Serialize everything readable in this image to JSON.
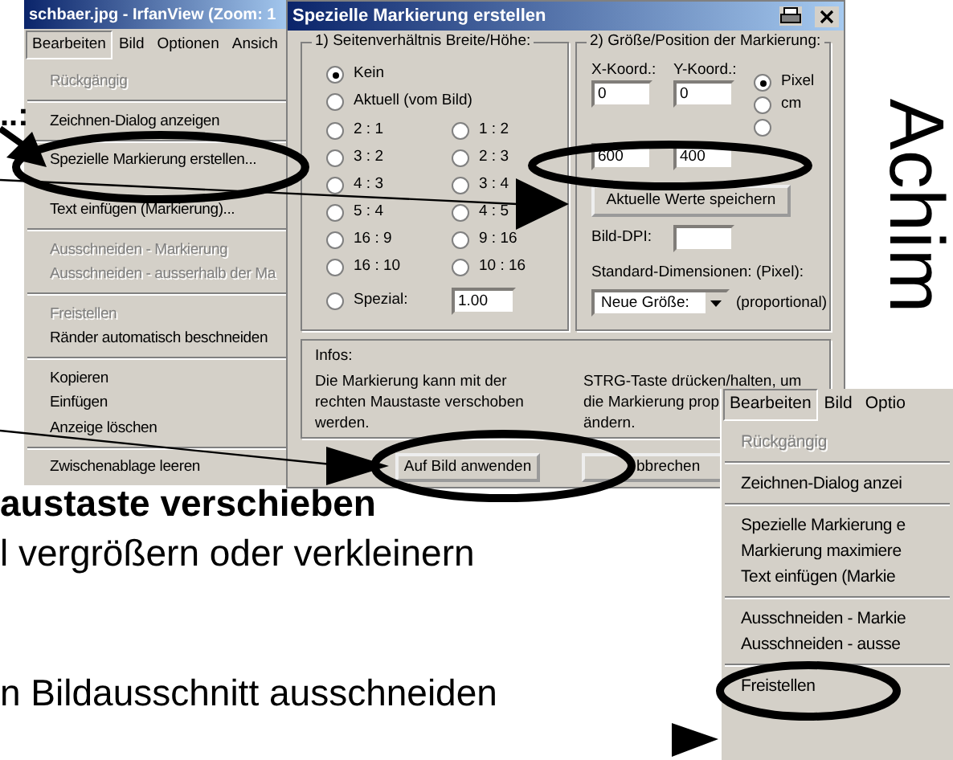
{
  "main_window": {
    "title": "schbaer.jpg - IrfanView (Zoom: 1",
    "menu_bar": [
      {
        "label": "Bearbeiten",
        "selected": true
      },
      {
        "label": "Bild",
        "selected": false
      },
      {
        "label": "Optionen",
        "selected": false
      },
      {
        "label": "Ansich",
        "selected": false
      }
    ],
    "menu_items": [
      {
        "kind": "item",
        "label": "Rückgängig",
        "disabled": true
      },
      {
        "kind": "separator"
      },
      {
        "kind": "item",
        "label": "Zeichnen-Dialog anzeigen",
        "disabled": false
      },
      {
        "kind": "separator"
      },
      {
        "kind": "item",
        "label": "Spezielle Markierung erstellen...",
        "disabled": false
      },
      {
        "kind": "covered"
      },
      {
        "kind": "item",
        "label": "Text einfügen (Markierung)...",
        "disabled": false
      },
      {
        "kind": "separator"
      },
      {
        "kind": "item",
        "label": "Ausschneiden - Markierung",
        "disabled": true
      },
      {
        "kind": "item",
        "label": "Ausschneiden - ausserhalb der Ma",
        "disabled": true
      },
      {
        "kind": "separator"
      },
      {
        "kind": "item",
        "label": "Freistellen",
        "disabled": true
      },
      {
        "kind": "item",
        "label": "Ränder automatisch beschneiden",
        "disabled": false
      },
      {
        "kind": "separator"
      },
      {
        "kind": "item",
        "label": "Kopieren",
        "disabled": false
      },
      {
        "kind": "item",
        "label": "Einfügen",
        "disabled": false
      },
      {
        "kind": "item",
        "label": "Anzeige löschen",
        "disabled": false
      },
      {
        "kind": "separator"
      },
      {
        "kind": "item",
        "label": "Zwischenablage leeren",
        "disabled": false
      }
    ]
  },
  "dialog": {
    "title": "Spezielle Markierung erstellen",
    "aspect_group": {
      "title": "1) Seitenverhältnis Breite/Höhe:",
      "single_options": [
        {
          "label": "Kein",
          "checked": true
        },
        {
          "label": "Aktuell (vom Bild)",
          "checked": false
        }
      ],
      "ratio_options": [
        {
          "label": "2 : 1",
          "checked": false
        },
        {
          "label": "1 : 2",
          "checked": false
        },
        {
          "label": "3 : 2",
          "checked": false
        },
        {
          "label": "2 : 3",
          "checked": false
        },
        {
          "label": "4 : 3",
          "checked": false
        },
        {
          "label": "3 : 4",
          "checked": false
        },
        {
          "label": "5 : 4",
          "checked": false
        },
        {
          "label": "4 : 5",
          "checked": false
        },
        {
          "label": "16 : 9",
          "checked": false
        },
        {
          "label": "9 : 16",
          "checked": false
        },
        {
          "label": "16 : 10",
          "checked": false
        },
        {
          "label": "10 : 16",
          "checked": false
        }
      ],
      "custom": {
        "label": "Spezial:",
        "checked": false,
        "value": "1.00"
      }
    },
    "size_group": {
      "title": "2) Größe/Position der Markierung:",
      "x_label": "X-Koord.:",
      "y_label": "Y-Koord.:",
      "x_value": "0",
      "y_value": "0",
      "units": [
        {
          "label": "Pixel",
          "checked": true
        },
        {
          "label": "cm",
          "checked": false
        },
        {
          "checked": false
        }
      ],
      "width_value": "600",
      "height_value": "400",
      "save_button": "Aktuelle Werte speichern",
      "dpi_label": "Bild-DPI:",
      "dims_label": "Standard-Dimensionen: (Pixel):",
      "dims_select": "Neue Größe:",
      "dims_note": "(proportional)"
    },
    "infos": {
      "title": "Infos:",
      "left_text": "Die Markierung kann mit der rechten Maustaste verschoben werden.",
      "right_lines": [
        "STRG-Taste drücken/halten, um",
        "die Markierung prop",
        "ändern."
      ]
    },
    "buttons": [
      "Auf Bild anwenden",
      "bbrechen"
    ]
  },
  "second_window": {
    "menu_bar": [
      {
        "label": "Bearbeiten",
        "selected": true
      },
      {
        "label": "Bild",
        "selected": false
      },
      {
        "label": "Optio",
        "selected": false
      }
    ],
    "menu_items": [
      {
        "kind": "item",
        "label": "Rückgängig",
        "disabled": true
      },
      {
        "kind": "separator"
      },
      {
        "kind": "item",
        "label": "Zeichnen-Dialog anzei",
        "disabled": false
      },
      {
        "kind": "separator"
      },
      {
        "kind": "item",
        "label": "Spezielle Markierung e",
        "disabled": false
      },
      {
        "kind": "item",
        "label": "Markierung maximiere",
        "disabled": false
      },
      {
        "kind": "item",
        "label": "Text einfügen (Markie",
        "disabled": false
      },
      {
        "kind": "separator"
      },
      {
        "kind": "item",
        "label": "Ausschneiden - Markie",
        "disabled": false
      },
      {
        "kind": "item",
        "label": "Ausschneiden - ausse",
        "disabled": false
      },
      {
        "kind": "separator"
      },
      {
        "kind": "item",
        "label": "Freistellen",
        "disabled": false
      },
      {
        "kind": "covered"
      }
    ]
  },
  "leader_text": "..:",
  "captions": [
    {
      "text": "austaste verschieben",
      "bold": true
    },
    {
      "text": "l vergrößern oder verkleinern",
      "bold": false
    },
    {
      "text": "n Bildausschnitt ausschneiden",
      "bold": false
    }
  ],
  "side_text": "Achim"
}
